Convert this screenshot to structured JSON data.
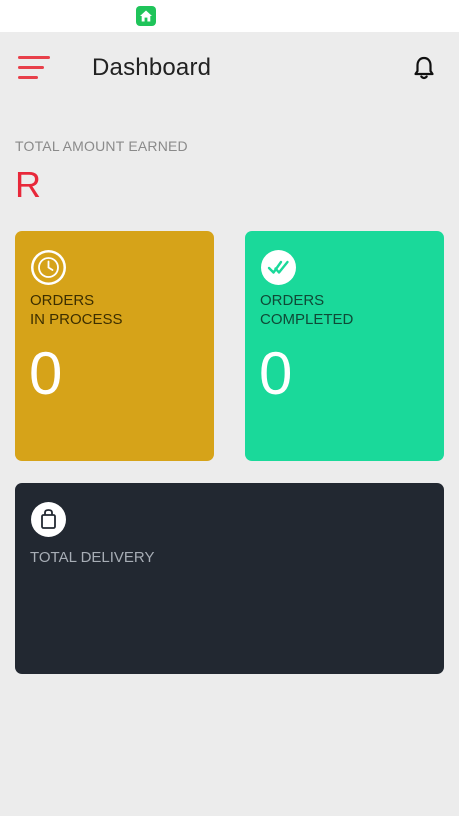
{
  "status_bar": {
    "app_icon": "home-icon"
  },
  "header": {
    "menu_icon": "menu-icon",
    "title": "Dashboard",
    "notification_icon": "bell-icon"
  },
  "earnings": {
    "label": "TOTAL AMOUNT EARNED",
    "value": "R"
  },
  "cards": {
    "in_process": {
      "icon": "clock-icon",
      "label": "ORDERS\nIN PROCESS",
      "count": "0",
      "color": "#d6a319"
    },
    "completed": {
      "icon": "double-check-icon",
      "label": "ORDERS\nCOMPLETED",
      "count": "0",
      "color": "#1ad99a"
    },
    "delivery": {
      "icon": "shopping-bag-icon",
      "label": "TOTAL DELIVERY",
      "color": "#222831"
    }
  },
  "colors": {
    "accent": "#e8283a",
    "background": "#ececec"
  }
}
